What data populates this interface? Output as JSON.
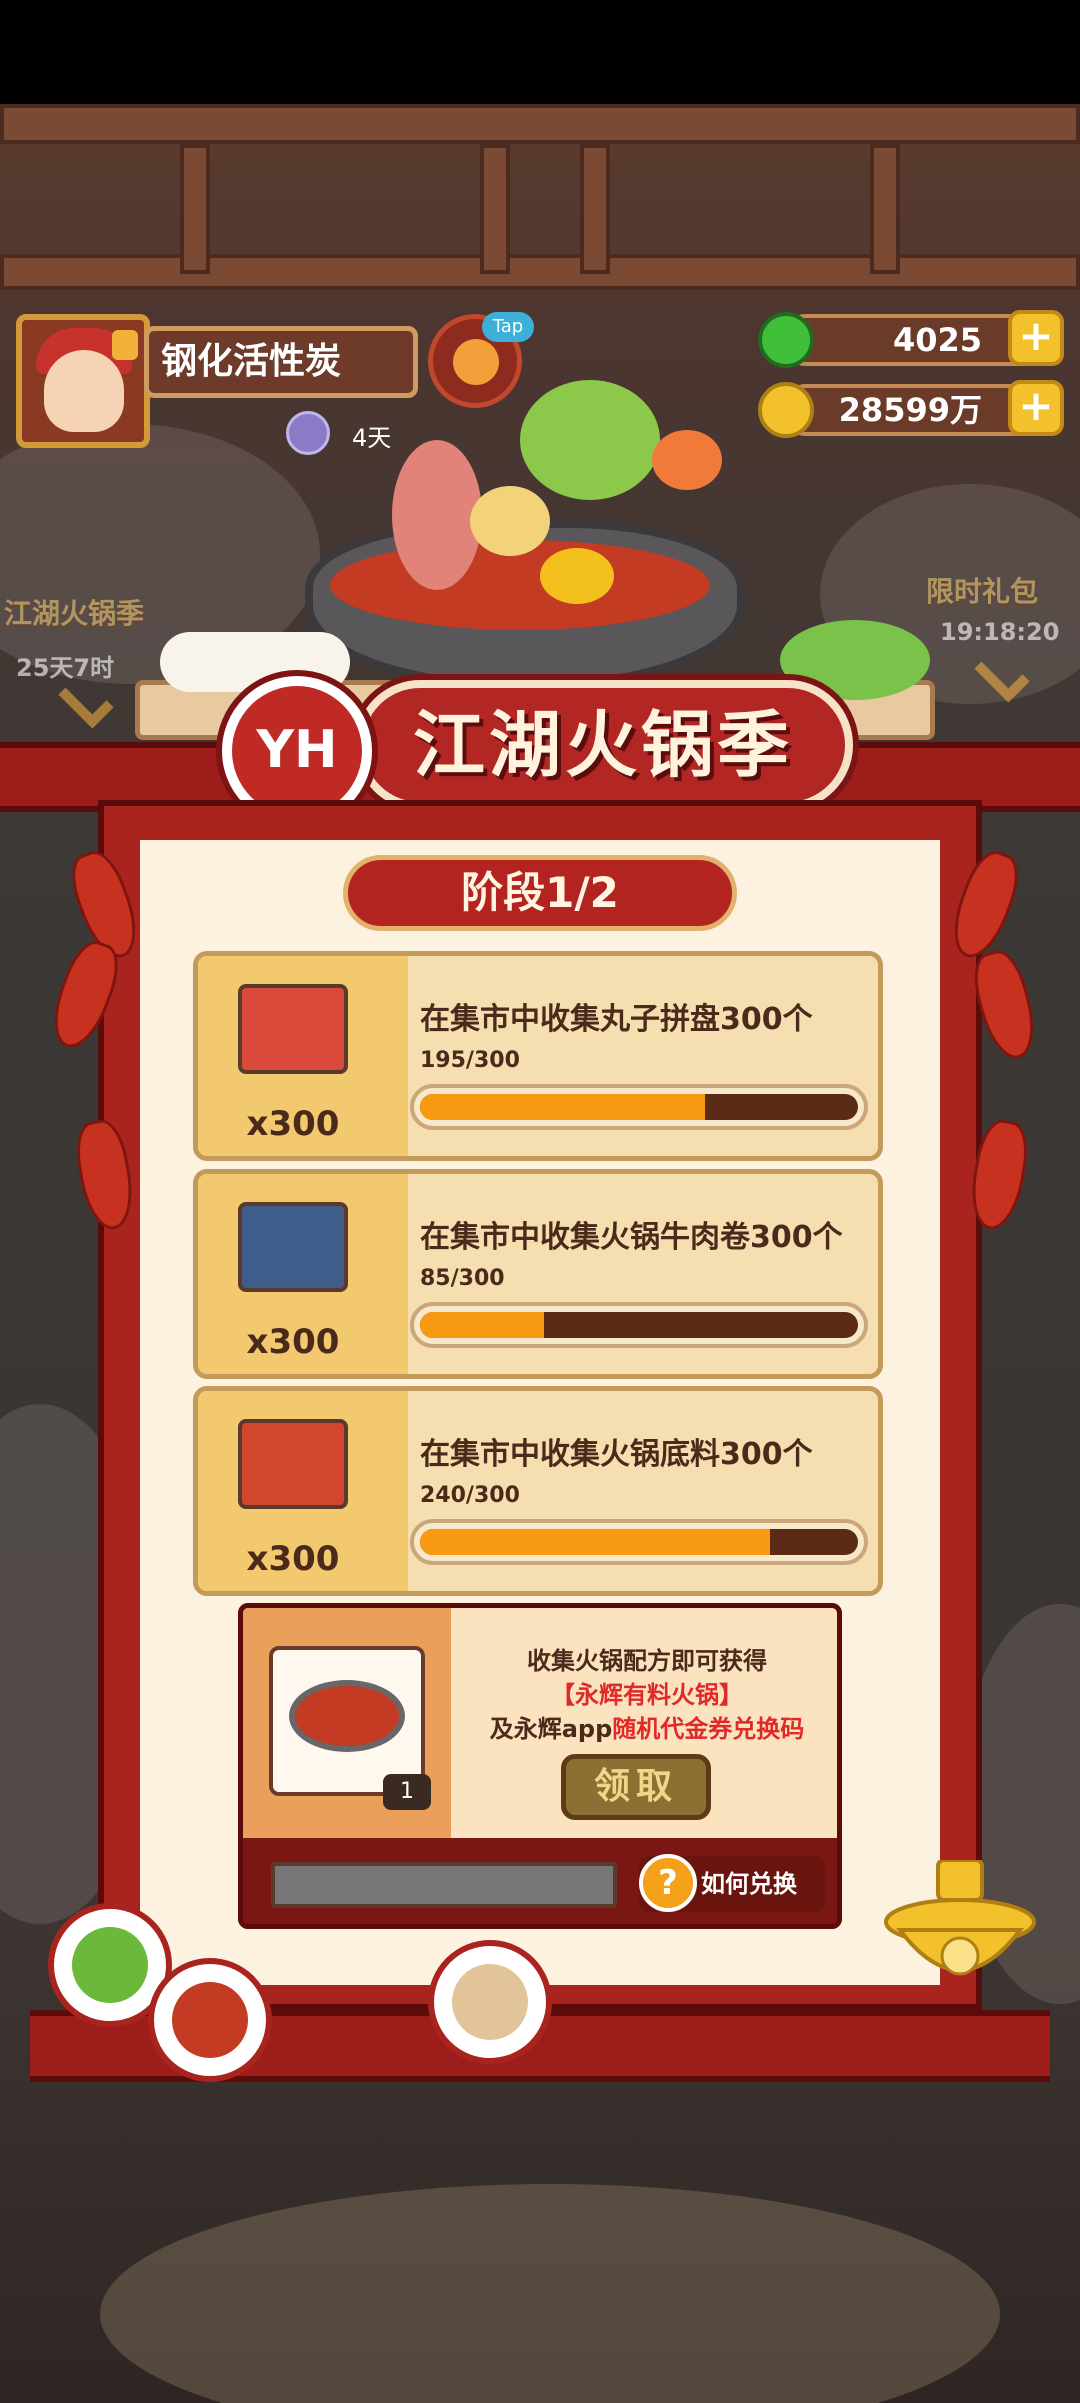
{
  "player": {
    "name": "钢化活性炭",
    "status_days": "4天",
    "tap_label": "Tap"
  },
  "currency": {
    "gems": "4025",
    "coins": "28599万"
  },
  "side": {
    "left_event_label": "江湖火锅季",
    "left_event_timer": "25天7时",
    "right_event_label": "限时礼包",
    "right_event_timer": "19:18:20"
  },
  "event": {
    "logo": "YH",
    "title": "江湖火锅季",
    "stage": "阶段1/2"
  },
  "tasks": [
    {
      "title": "在集市中收集丸子拼盘300个",
      "progress_text": "195/300",
      "progress": 0.65,
      "qty": "x300",
      "img_color": "#d94a3a"
    },
    {
      "title": "在集市中收集火锅牛肉卷300个",
      "progress_text": "85/300",
      "progress": 0.283,
      "qty": "x300",
      "img_color": "#3f5d8a"
    },
    {
      "title": "在集市中收集火锅底料300个",
      "progress_text": "240/300",
      "progress": 0.8,
      "qty": "x300",
      "img_color": "#d2462e"
    }
  ],
  "reward": {
    "line1": "收集火锅配方即可获得",
    "line2": "【永辉有料火锅】",
    "line3_prefix": "及永辉app",
    "line3_red": "随机代金券兑换码",
    "count": "1",
    "claim_label": "领取",
    "help_label": "如何兑换",
    "help_icon": "?"
  },
  "colors": {
    "accent_red": "#b32320",
    "progress_fill": "#f79a12",
    "panel_bg": "#fdf1df"
  }
}
